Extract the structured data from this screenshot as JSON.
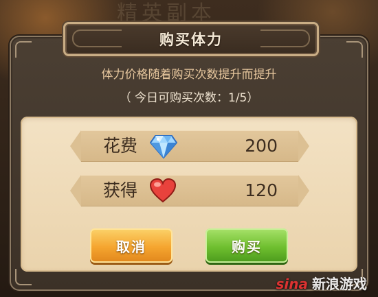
{
  "background": {
    "title_text": "精英副本"
  },
  "dialog": {
    "title": "购买体力",
    "description": "体力价格随着购买次数提升而提升",
    "remaining": "（ 今日可购买次数：1/5）"
  },
  "cost": {
    "label": "花费",
    "icon": "diamond-icon",
    "value": "200"
  },
  "gain": {
    "label": "获得",
    "icon": "heart-icon",
    "value": "120"
  },
  "buttons": {
    "cancel": "取消",
    "buy": "购买"
  },
  "watermark": {
    "brand": "sina",
    "text": "新浪游戏"
  },
  "colors": {
    "cancel_button": "#f5a52f",
    "buy_button": "#6fbf2f",
    "panel": "#f3e2c4"
  }
}
